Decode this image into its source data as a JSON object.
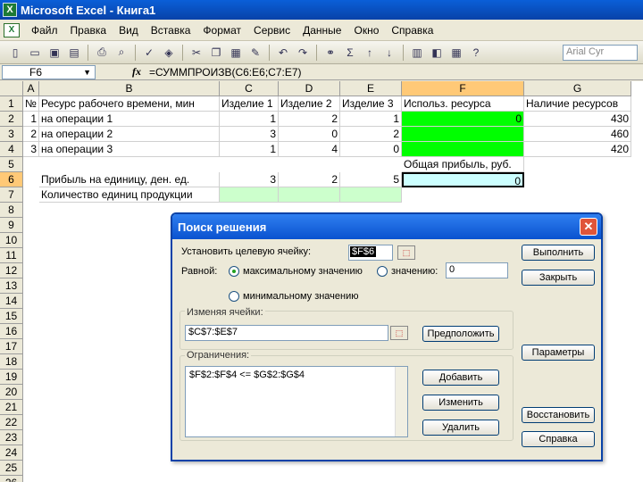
{
  "app": {
    "title": "Microsoft Excel - Книга1",
    "icon": "excel-icon"
  },
  "menu": [
    "Файл",
    "Правка",
    "Вид",
    "Вставка",
    "Формат",
    "Сервис",
    "Данные",
    "Окно",
    "Справка"
  ],
  "toolbar": {
    "font_name": "Arial Cyr"
  },
  "formula_bar": {
    "name_box": "F6",
    "fx": "fx",
    "formula": "=СУММПРОИЗВ(C6:E6;C7:E7)"
  },
  "columns": [
    "A",
    "B",
    "C",
    "D",
    "E",
    "F",
    "G"
  ],
  "rows": [
    "1",
    "2",
    "3",
    "4",
    "5",
    "6",
    "7",
    "8",
    "9",
    "10",
    "11",
    "12",
    "13",
    "14",
    "15",
    "16",
    "17",
    "18",
    "19",
    "20",
    "21",
    "22",
    "23",
    "24",
    "25",
    "26"
  ],
  "cells": {
    "A1": "№",
    "B1": "Ресурс рабочего времени, мин",
    "C1": "Изделие 1",
    "D1": "Изделие 2",
    "E1": "Изделие 3",
    "F1": "Использ. ресурса",
    "G1": "Наличие ресурсов",
    "A2": "1",
    "B2": "на операции 1",
    "C2": "1",
    "D2": "2",
    "E2": "1",
    "F2": "0",
    "G2": "430",
    "A3": "2",
    "B3": "на операции 2",
    "C3": "3",
    "D3": "0",
    "E3": "2",
    "G3": "460",
    "A4": "3",
    "B4": "на операции 3",
    "C4": "1",
    "D4": "4",
    "E4": "0",
    "G4": "420",
    "F5": "Общая прибыль, руб.",
    "B6": "Прибыль на единицу, ден. ед.",
    "C6": "3",
    "D6": "2",
    "E6": "5",
    "F6": "0",
    "B7": "Количество единиц продукции"
  },
  "dialog": {
    "title": "Поиск решения",
    "target_label": "Установить целевую ячейку:",
    "target_value": "$F$6",
    "equal_label": "Равной:",
    "opt_max": "максимальному значению",
    "opt_value": "значению:",
    "value_input": "0",
    "opt_min": "минимальному значению",
    "changing_label": "Изменяя ячейки:",
    "changing_value": "$C$7:$E$7",
    "constraints_label": "Ограничения:",
    "constraints": [
      "$F$2:$F$4 <= $G$2:$G$4"
    ],
    "buttons": {
      "solve": "Выполнить",
      "close": "Закрыть",
      "guess": "Предположить",
      "options": "Параметры",
      "add": "Добавить",
      "change": "Изменить",
      "delete": "Удалить",
      "reset": "Восстановить",
      "help": "Справка"
    }
  }
}
